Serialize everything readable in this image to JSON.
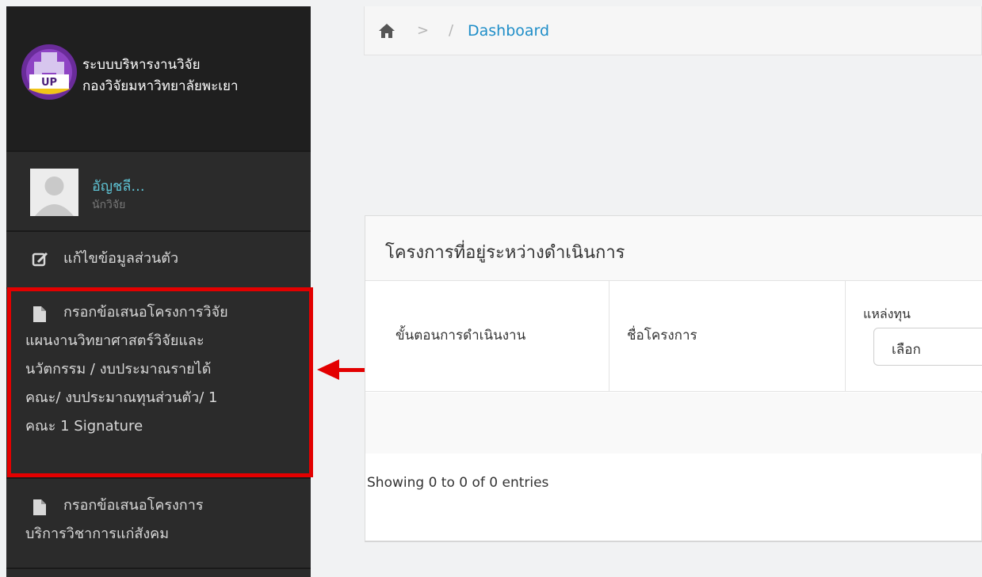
{
  "sidebar": {
    "brand_line1": "ระบบบริหารงานวิจัย",
    "brand_line2": "กองวิจัยมหาวิทยาลัยพะเยา",
    "logo_text": "UP",
    "user": {
      "name": "อัญชลี...",
      "role": "นักวิจัย"
    },
    "menu": [
      {
        "label": "แก้ไขข้อมูลส่วนตัว",
        "icon": "edit-icon"
      },
      {
        "lines": [
          "กรอกข้อเสนอโครงการวิจัย",
          "แผนงานวิทยาศาสตร์วิจัยและ",
          "นวัตกรรม / งบประมาณรายได้",
          "คณะ/ งบประมาณทุนส่วนตัว/ 1",
          "คณะ 1 Signature"
        ],
        "icon": "file-icon"
      },
      {
        "lines": [
          "กรอกข้อเสนอโครงการ",
          "บริการวิชาการแก่สังคม"
        ],
        "icon": "file-icon"
      }
    ]
  },
  "annotation": {
    "number": "1",
    "color": "#e30000"
  },
  "breadcrumb": {
    "sep1": ">",
    "sep2": "/",
    "current": "Dashboard"
  },
  "panel": {
    "title": "โครงการที่อยู่ระหว่างดำเนินการ",
    "columns": [
      "ขั้นตอนการดำเนินงาน",
      "ชื่อโครงการ",
      "แหล่งทุน"
    ],
    "filter_select_value": "เลือก",
    "info": "Showing 0 to 0 of 0 entries"
  },
  "colors": {
    "sidebar_bg": "#2b2b2b",
    "brand_bg": "#1f1f1f",
    "link": "#1f8ec8",
    "username": "#5ec2d3"
  }
}
